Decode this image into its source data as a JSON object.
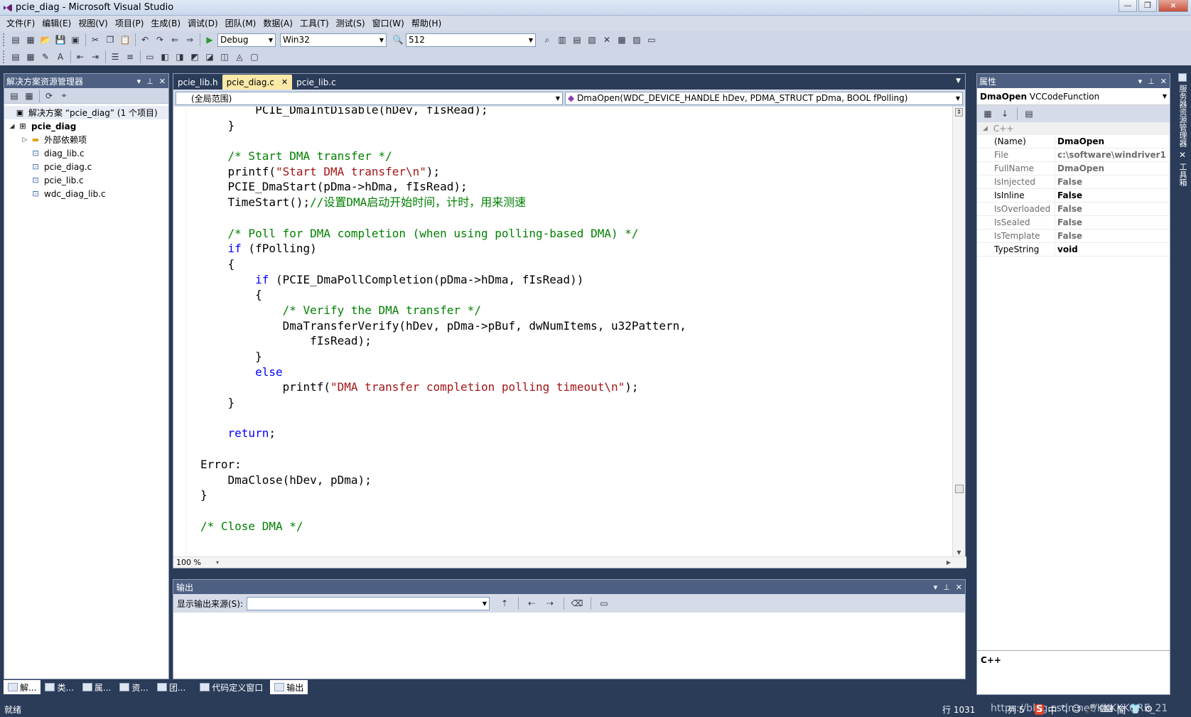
{
  "window": {
    "title": "pcie_diag - Microsoft Visual Studio",
    "minimize": "0",
    "maximize": "1",
    "close": "×"
  },
  "menu": [
    "文件(F)",
    "编辑(E)",
    "视图(V)",
    "项目(P)",
    "生成(B)",
    "调试(D)",
    "团队(M)",
    "数据(A)",
    "工具(T)",
    "测试(S)",
    "窗口(W)",
    "帮助(H)"
  ],
  "toolbar": {
    "config": "Debug",
    "platform": "Win32",
    "find_value": "512",
    "start_icon": "▶"
  },
  "solution_explorer": {
    "title": "解决方案资源管理器",
    "pin": "♦ ⊣ ×",
    "solution_label": "解决方案 “pcie_diag” (1 个项目)",
    "project": "pcie_diag",
    "items": [
      "外部依赖项",
      "diag_lib.c",
      "pcie_diag.c",
      "pcie_lib.c",
      "wdc_diag_lib.c"
    ]
  },
  "bottom_tabs": [
    "解...",
    "类...",
    "属...",
    "资...",
    "团...",
    "代码定义窗口",
    "输出"
  ],
  "editor": {
    "tabs": [
      "pcie_lib.h",
      "pcie_diag.c",
      "pcie_lib.c"
    ],
    "active_tab": "pcie_diag.c",
    "scope": "(全局范围)",
    "member": "DmaOpen(WDC_DEVICE_HANDLE hDev, PDMA_STRUCT pDma, BOOL fPolling)",
    "zoom": "100 %"
  },
  "code_lines": [
    [
      [
        "",
        "        PCIE_DmaIntDisable(hDev, fIsRead);"
      ]
    ],
    [
      [
        "",
        "    }"
      ]
    ],
    [
      [
        "",
        ""
      ]
    ],
    [
      [
        "",
        "    "
      ],
      [
        "cm",
        "/* Start DMA transfer */"
      ]
    ],
    [
      [
        "",
        "    printf("
      ],
      [
        "st",
        "\"Start DMA transfer\\n\""
      ],
      [
        "",
        ");"
      ]
    ],
    [
      [
        "",
        "    PCIE_DmaStart(pDma->hDma, fIsRead);"
      ]
    ],
    [
      [
        "",
        "    TimeStart();"
      ],
      [
        "cm",
        "//设置DMA启动开始时间，计时，用来测速"
      ]
    ],
    [
      [
        "",
        ""
      ]
    ],
    [
      [
        "",
        "    "
      ],
      [
        "cm",
        "/* Poll for DMA completion (when using polling-based DMA) */"
      ]
    ],
    [
      [
        "",
        "    "
      ],
      [
        "kw",
        "if"
      ],
      [
        "",
        " (fPolling)"
      ]
    ],
    [
      [
        "",
        "    {"
      ]
    ],
    [
      [
        "",
        "        "
      ],
      [
        "kw",
        "if"
      ],
      [
        "",
        " (PCIE_DmaPollCompletion(pDma->hDma, fIsRead))"
      ]
    ],
    [
      [
        "",
        "        {"
      ]
    ],
    [
      [
        "",
        "            "
      ],
      [
        "cm",
        "/* Verify the DMA transfer */"
      ]
    ],
    [
      [
        "",
        "            DmaTransferVerify(hDev, pDma->pBuf, dwNumItems, u32Pattern,"
      ]
    ],
    [
      [
        "",
        "                fIsRead);"
      ]
    ],
    [
      [
        "",
        "        }"
      ]
    ],
    [
      [
        "",
        "        "
      ],
      [
        "kw",
        "else"
      ]
    ],
    [
      [
        "",
        "            printf("
      ],
      [
        "st",
        "\"DMA transfer completion polling timeout\\n\""
      ],
      [
        "",
        ");"
      ]
    ],
    [
      [
        "",
        "    }"
      ]
    ],
    [
      [
        "",
        ""
      ]
    ],
    [
      [
        "",
        "    "
      ],
      [
        "kw",
        "return"
      ],
      [
        "",
        ";"
      ]
    ],
    [
      [
        "",
        ""
      ]
    ],
    [
      [
        "",
        "Error:"
      ]
    ],
    [
      [
        "",
        "    DmaClose(hDev, pDma);"
      ]
    ],
    [
      [
        "",
        "}"
      ]
    ],
    [
      [
        "",
        ""
      ]
    ],
    [
      [
        "",
        ""
      ],
      [
        "cm",
        "/* Close DMA */"
      ]
    ]
  ],
  "output": {
    "title": "输出",
    "source_label": "显示输出来源(S):",
    "source_value": ""
  },
  "properties": {
    "title": "属性",
    "object": "DmaOpen",
    "object_type": "VCCodeFunction",
    "category": "C++",
    "rows": [
      {
        "name": "(Name)",
        "value": "DmaOpen",
        "ro": false
      },
      {
        "name": "File",
        "value": "c:\\software\\windriver1",
        "ro": true
      },
      {
        "name": "FullName",
        "value": "DmaOpen",
        "ro": true
      },
      {
        "name": "IsInjected",
        "value": "False",
        "ro": true
      },
      {
        "name": "IsInline",
        "value": "False",
        "ro": false
      },
      {
        "name": "IsOverloaded",
        "value": "False",
        "ro": true
      },
      {
        "name": "IsSealed",
        "value": "False",
        "ro": true
      },
      {
        "name": "IsTemplate",
        "value": "False",
        "ro": true
      },
      {
        "name": "TypeString",
        "value": "void",
        "ro": false
      }
    ],
    "description": "C++"
  },
  "right_tabs": [
    "服务器资源管理器",
    "工具箱"
  ],
  "status": {
    "ready": "就绪",
    "row": "行 1031",
    "col": "列 5",
    "watermark": "https://blog.csdn.net/KKKKKORE_21",
    "ime": [
      "中",
      "°,",
      "☺",
      "🎤",
      "⌨",
      "简",
      "👕",
      "⚙"
    ]
  },
  "colors": {
    "keyword": "#0000ff",
    "comment": "#008000",
    "string": "#a31515",
    "chrome": "#2b3c59",
    "pane_header": "#4d6082",
    "active_tab": "#fbe9a8"
  }
}
